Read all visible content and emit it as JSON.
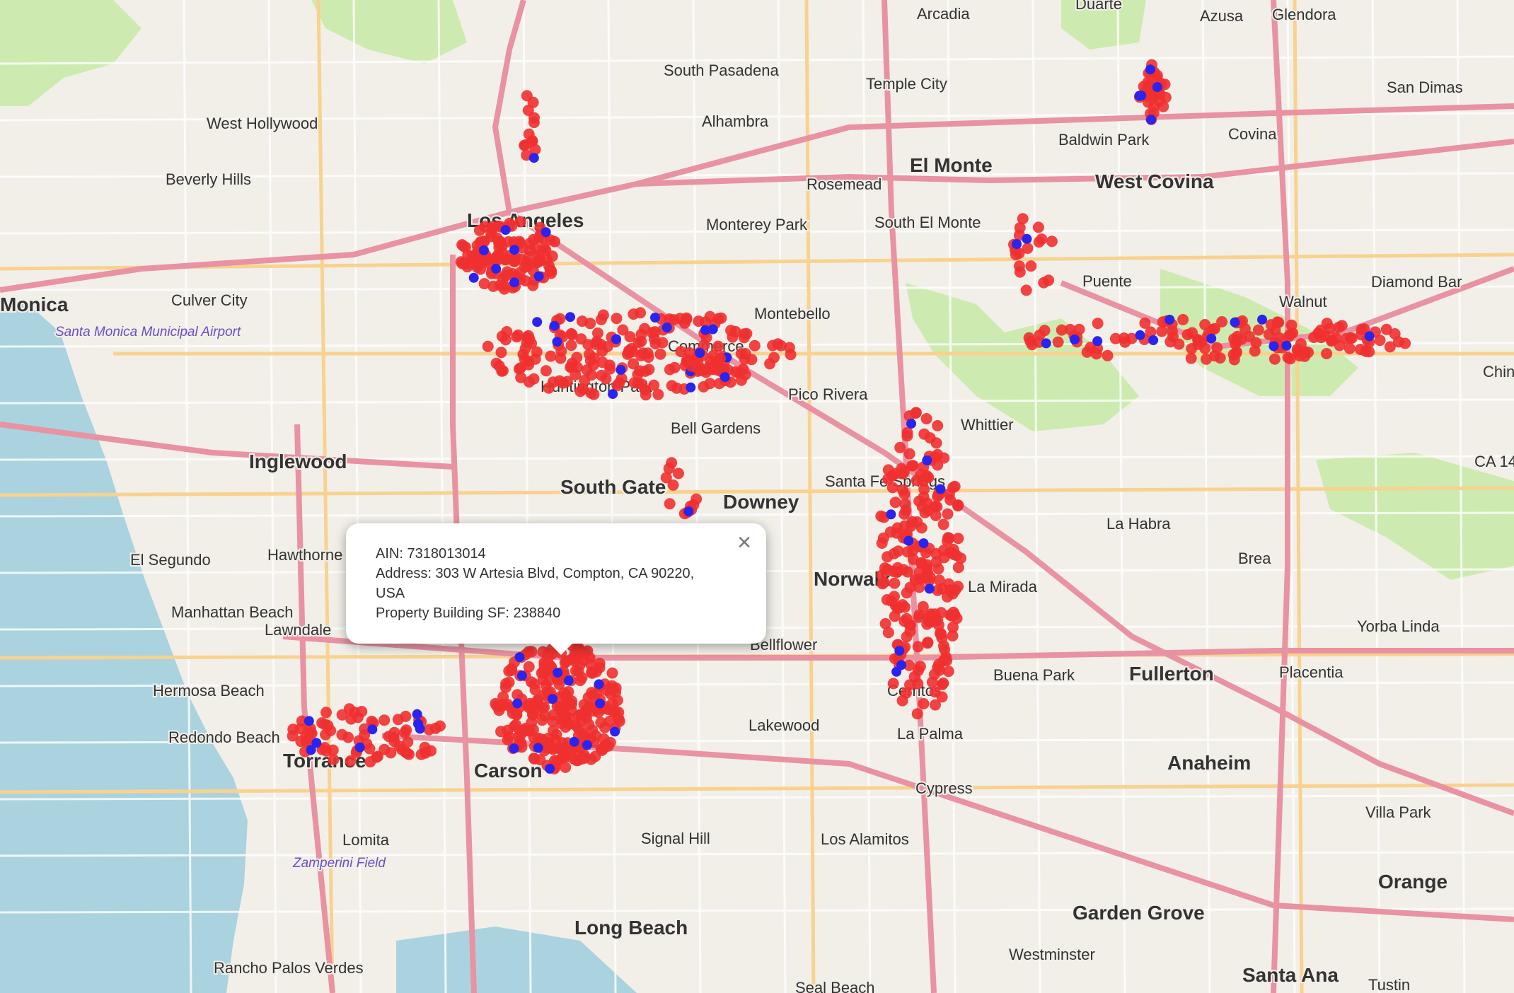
{
  "popup": {
    "ain": "AIN: 7318013014",
    "address": "Address: 303 W Artesia Blvd, Compton, CA 90220, USA",
    "building_sf": "Property Building SF: 238840",
    "close_label": "×"
  },
  "places": [
    {
      "name": "Arcadia",
      "kind": "town"
    },
    {
      "name": "Duarte",
      "kind": "town"
    },
    {
      "name": "Azusa",
      "kind": "town"
    },
    {
      "name": "Glendora",
      "kind": "town"
    },
    {
      "name": "South Pasadena",
      "kind": "town"
    },
    {
      "name": "Temple City",
      "kind": "town"
    },
    {
      "name": "San Dimas",
      "kind": "town"
    },
    {
      "name": "West Hollywood",
      "kind": "town"
    },
    {
      "name": "Alhambra",
      "kind": "town"
    },
    {
      "name": "Baldwin Park",
      "kind": "town"
    },
    {
      "name": "Covina",
      "kind": "town"
    },
    {
      "name": "El Monte",
      "kind": "city"
    },
    {
      "name": "Beverly Hills",
      "kind": "town"
    },
    {
      "name": "Rosemead",
      "kind": "town"
    },
    {
      "name": "West Covina",
      "kind": "city"
    },
    {
      "name": "Los Angeles",
      "kind": "city"
    },
    {
      "name": "Monterey Park",
      "kind": "town"
    },
    {
      "name": "South El Monte",
      "kind": "town"
    },
    {
      "name": "Puente",
      "kind": "town"
    },
    {
      "name": "Walnut",
      "kind": "town"
    },
    {
      "name": "Diamond Bar",
      "kind": "town"
    },
    {
      "name": "Monica",
      "kind": "city"
    },
    {
      "name": "Culver City",
      "kind": "town"
    },
    {
      "name": "Montebello",
      "kind": "town"
    },
    {
      "name": "Commerce",
      "kind": "town"
    },
    {
      "name": "Santa Monica Municipal Airport",
      "kind": "airport"
    },
    {
      "name": "Huntington Park",
      "kind": "town"
    },
    {
      "name": "Pico Rivera",
      "kind": "town"
    },
    {
      "name": "Whittier",
      "kind": "town"
    },
    {
      "name": "Bell Gardens",
      "kind": "town"
    },
    {
      "name": "Inglewood",
      "kind": "city"
    },
    {
      "name": "South Gate",
      "kind": "city"
    },
    {
      "name": "Santa Fe Springs",
      "kind": "town"
    },
    {
      "name": "Downey",
      "kind": "city"
    },
    {
      "name": "La Habra",
      "kind": "town"
    },
    {
      "name": "El Segundo",
      "kind": "town"
    },
    {
      "name": "Hawthorne",
      "kind": "town"
    },
    {
      "name": "Brea",
      "kind": "town"
    },
    {
      "name": "Norwalk",
      "kind": "city"
    },
    {
      "name": "La Mirada",
      "kind": "town"
    },
    {
      "name": "Manhattan Beach",
      "kind": "town"
    },
    {
      "name": "Lawndale",
      "kind": "town"
    },
    {
      "name": "Yorba Linda",
      "kind": "town"
    },
    {
      "name": "Bellflower",
      "kind": "town"
    },
    {
      "name": "Placentia",
      "kind": "town"
    },
    {
      "name": "Fullerton",
      "kind": "city"
    },
    {
      "name": "Buena Park",
      "kind": "town"
    },
    {
      "name": "Hermosa Beach",
      "kind": "town"
    },
    {
      "name": "Cerritos",
      "kind": "town"
    },
    {
      "name": "Lakewood",
      "kind": "town"
    },
    {
      "name": "Redondo Beach",
      "kind": "town"
    },
    {
      "name": "La Palma",
      "kind": "town"
    },
    {
      "name": "Torrance",
      "kind": "city"
    },
    {
      "name": "Carson",
      "kind": "city"
    },
    {
      "name": "Anaheim",
      "kind": "city"
    },
    {
      "name": "Cypress",
      "kind": "town"
    },
    {
      "name": "Villa Park",
      "kind": "town"
    },
    {
      "name": "Signal Hill",
      "kind": "town"
    },
    {
      "name": "Los Alamitos",
      "kind": "town"
    },
    {
      "name": "Lomita",
      "kind": "town"
    },
    {
      "name": "Zamperini Field",
      "kind": "airport"
    },
    {
      "name": "Orange",
      "kind": "city"
    },
    {
      "name": "Long Beach",
      "kind": "city"
    },
    {
      "name": "Garden Grove",
      "kind": "city"
    },
    {
      "name": "Westminster",
      "kind": "town"
    },
    {
      "name": "Rancho Palos Verdes",
      "kind": "town"
    },
    {
      "name": "Santa Ana",
      "kind": "city"
    },
    {
      "name": "Tustin",
      "kind": "town"
    },
    {
      "name": "Seal Beach",
      "kind": "town"
    },
    {
      "name": "Chin",
      "kind": "town"
    },
    {
      "name": "CA 14",
      "kind": "town"
    }
  ],
  "colors": {
    "land": "#f2efe9",
    "water": "#aad3df",
    "park": "#cdebb0",
    "road": "#f8d28e",
    "motorway": "#e892a2",
    "marker_red": "#f03030",
    "marker_blue": "#2a24ee"
  },
  "markers": {
    "red_count_label": "",
    "clusters": [
      {
        "name": "Los Angeles downtown",
        "kind": "cluster"
      },
      {
        "name": "Commerce / Pico Rivera",
        "kind": "cluster"
      },
      {
        "name": "Baldwin Park",
        "kind": "cluster"
      },
      {
        "name": "Pomona Fwy corridor",
        "kind": "cluster"
      },
      {
        "name": "Santa Fe Springs / La Mirada",
        "kind": "cluster"
      },
      {
        "name": "Compton / Carson",
        "kind": "cluster"
      },
      {
        "name": "Torrance",
        "kind": "cluster"
      }
    ]
  }
}
